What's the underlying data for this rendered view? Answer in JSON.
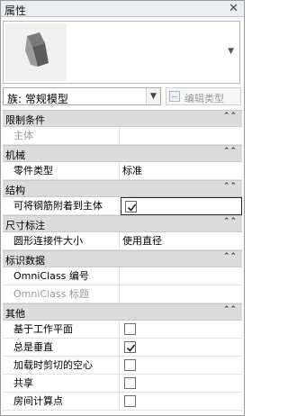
{
  "panel": {
    "title": "属性",
    "close_glyph": "✕"
  },
  "preview": {
    "thumbnail_icon": "family-3d-thumbnail-icon",
    "dropdown_glyph": "▼"
  },
  "type_selector": {
    "label": "族: 常规模型",
    "dropdown_glyph": "▼"
  },
  "edit_type": {
    "label": "编辑类型",
    "icon": "edit-type-icon"
  },
  "sections": [
    {
      "title": "限制条件",
      "collapse_glyph": "⌃⌃",
      "rows": [
        {
          "name": "主体",
          "value": "",
          "dim": true,
          "kind": "text"
        }
      ]
    },
    {
      "title": "机械",
      "collapse_glyph": "⌃⌃",
      "rows": [
        {
          "name": "零件类型",
          "value": "标准",
          "dim": false,
          "kind": "text"
        }
      ]
    },
    {
      "title": "结构",
      "collapse_glyph": "⌃⌃",
      "rows": [
        {
          "name": "可将钢筋附着到主体",
          "checked": true,
          "dim": false,
          "kind": "checkbox",
          "focus": true
        }
      ]
    },
    {
      "title": "尺寸标注",
      "collapse_glyph": "⌃⌃",
      "rows": [
        {
          "name": "圆形连接件大小",
          "value": "使用直径",
          "dim": false,
          "kind": "text"
        }
      ]
    },
    {
      "title": "标识数据",
      "collapse_glyph": "⌃⌃",
      "rows": [
        {
          "name": "OmniClass 编号",
          "value": "",
          "dim": false,
          "kind": "text"
        },
        {
          "name": "OmniClass 标题",
          "value": "",
          "dim": true,
          "kind": "text"
        }
      ]
    },
    {
      "title": "其他",
      "collapse_glyph": "⌃⌃",
      "rows": [
        {
          "name": "基于工作平面",
          "checked": false,
          "dim": false,
          "kind": "checkbox"
        },
        {
          "name": "总是垂直",
          "checked": true,
          "dim": false,
          "kind": "checkbox"
        },
        {
          "name": "加载时剪切的空心",
          "checked": false,
          "dim": false,
          "kind": "checkbox"
        },
        {
          "name": "共享",
          "checked": false,
          "dim": false,
          "kind": "checkbox"
        },
        {
          "name": "房间计算点",
          "checked": false,
          "dim": false,
          "kind": "checkbox"
        }
      ]
    }
  ]
}
